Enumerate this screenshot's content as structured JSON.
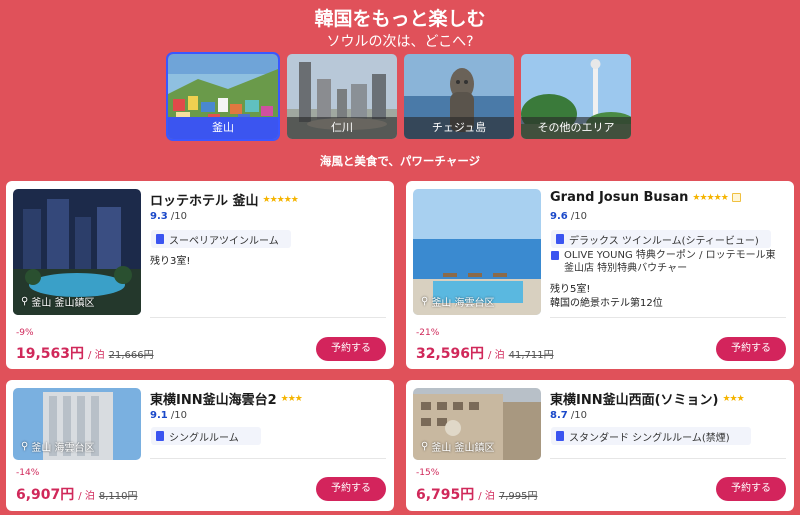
{
  "header": {
    "title": "韓国をもっと楽しむ",
    "subtitle": "ソウルの次は、どこへ?"
  },
  "destinations": [
    {
      "label": "釜山",
      "selected": true
    },
    {
      "label": "仁川",
      "selected": false
    },
    {
      "label": "チェジュ島",
      "selected": false
    },
    {
      "label": "その他のエリア",
      "selected": false
    }
  ],
  "tagline": "海風と美食で、パワーチャージ",
  "hotels": [
    {
      "name": "ロッテホテル 釜山",
      "stars": "★★★★★",
      "score": "9.3",
      "score_max": "/10",
      "location": "釜山 釜山鎮区",
      "room": "スーペリアツインルーム",
      "note": "残り3室!",
      "discount": "-9%",
      "price": "19,563円",
      "per": "/ 泊",
      "old_price": "21,666円",
      "book_label": "予約する"
    },
    {
      "name": "Grand Josun Busan",
      "stars": "★★★★★",
      "score": "9.6",
      "score_max": "/10",
      "location": "釜山 海雲台区",
      "room": "デラックス ツインルーム(シティービュー)",
      "perk": "OLIVE YOUNG 特典クーポン / ロッテモール東釜山店 特別特典バウチャー",
      "note": "残り5室!",
      "note2": "韓国の絶景ホテル第12位",
      "discount": "-21%",
      "price": "32,596円",
      "per": "/ 泊",
      "old_price": "41,711円",
      "book_label": "予約する"
    },
    {
      "name": "東横INN釜山海雲台2",
      "stars": "★★★",
      "score": "9.1",
      "score_max": "/10",
      "location": "釜山 海雲台区",
      "room": "シングルルーム",
      "discount": "-14%",
      "price": "6,907円",
      "per": "/ 泊",
      "old_price": "8,110円",
      "book_label": "予約する"
    },
    {
      "name": "東横INN釜山西面(ソミョン)",
      "stars": "★★★",
      "score": "8.7",
      "score_max": "/10",
      "location": "釜山 釜山鎮区",
      "room": "スタンダード シングルルーム(禁煙)",
      "discount": "-15%",
      "price": "6,795円",
      "per": "/ 泊",
      "old_price": "7,995円",
      "book_label": "予約する"
    }
  ],
  "colors": {
    "background": "#e0515a",
    "accent": "#3b55f0",
    "price": "#d0285a",
    "button": "#d3245c"
  }
}
